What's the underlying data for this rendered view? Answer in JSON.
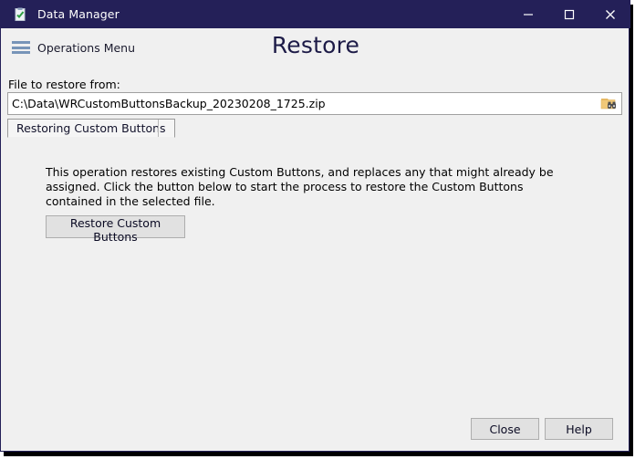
{
  "window": {
    "title": "Data Manager",
    "app_icon": "clipboard-check-icon",
    "accent_color": "#242058",
    "background_color": "#f0f0f0",
    "controls": {
      "minimize": "minimize-icon",
      "maximize": "maximize-icon",
      "close": "close-icon"
    }
  },
  "header": {
    "menu_icon": "hamburger-icon",
    "menu_label": "Operations Menu",
    "page_title": "Restore"
  },
  "file_section": {
    "label": "File to restore from:",
    "value": "C:\\Data\\WRCustomButtonsBackup_20230208_1725.zip",
    "placeholder": "",
    "browse_icon": "folder-browse-icon"
  },
  "tabs": [
    {
      "label": "Restoring Custom Buttons",
      "selected": true
    }
  ],
  "panel": {
    "description": "This operation restores existing Custom Buttons, and replaces any that might already be assigned. Click the button below to start the process to restore the Custom Buttons contained in the selected file.",
    "action_button": "Restore Custom Buttons"
  },
  "footer": {
    "close_label": "Close",
    "help_label": "Help"
  }
}
